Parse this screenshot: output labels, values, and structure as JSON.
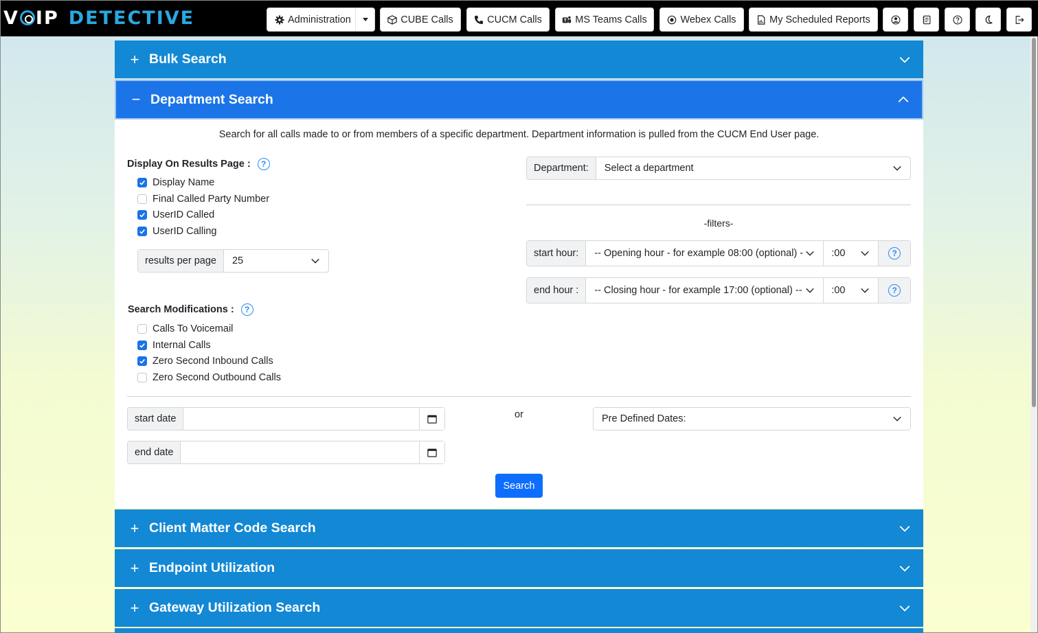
{
  "logo": {
    "part1": "V",
    "part2": "IP",
    "part3": "DETECTIVE"
  },
  "nav": {
    "administration": "Administration",
    "cube_calls": "CUBE Calls",
    "cucm_calls": "CUCM Calls",
    "ms_teams_calls": "MS Teams Calls",
    "webex_calls": "Webex Calls",
    "scheduled_reports": "My Scheduled Reports",
    "icon_buttons": [
      "user-circle-icon",
      "journal-icon",
      "question-circle-icon",
      "moon-icon",
      "logout-icon"
    ]
  },
  "accordion": {
    "bulk_search": "Bulk Search",
    "department_search": "Department Search",
    "client_matter": "Client Matter Code Search",
    "endpoint_utilization": "Endpoint Utilization",
    "gateway_utilization": "Gateway Utilization Search",
    "collapsed_sign": "+",
    "expanded_sign": "−"
  },
  "panel": {
    "intro": "Search for all calls made to or from members of a specific department. Department information is pulled from the CUCM End User page.",
    "display_title": "Display On Results Page :",
    "display_options": [
      {
        "label": "Display Name",
        "checked": true
      },
      {
        "label": "Final Called Party Number",
        "checked": false
      },
      {
        "label": "UserID Called",
        "checked": true
      },
      {
        "label": "UserID Calling",
        "checked": true
      }
    ],
    "results_per_page_label": "results per page",
    "results_per_page_value": "25",
    "mods_title": "Search Modifications :",
    "mods_options": [
      {
        "label": "Calls To Voicemail",
        "checked": false
      },
      {
        "label": "Internal Calls",
        "checked": true
      },
      {
        "label": "Zero Second Inbound Calls",
        "checked": true
      },
      {
        "label": "Zero Second Outbound Calls",
        "checked": false
      }
    ],
    "department_label": "Department:",
    "department_value": "Select a department",
    "filters_label": "-filters-",
    "start_hour_label": "start hour:",
    "start_hour_value": "-- Opening hour - for example 08:00 (optional) -",
    "start_minute_value": ":00",
    "end_hour_label": "end hour :",
    "end_hour_value": "-- Closing hour - for example 17:00 (optional) --",
    "end_minute_value": ":00",
    "start_date_label": "start date",
    "start_date_value": "",
    "end_date_label": "end date",
    "end_date_value": "",
    "or_label": "or",
    "predefined_dates": "Pre Defined Dates:",
    "search_button": "Search",
    "help_glyph": "?"
  },
  "colors": {
    "navbar": "#000000",
    "accordion": "#1388d4",
    "accordion_active": "#1c75e8",
    "primary": "#0d6efd",
    "logo_accent": "#2aa8e0"
  }
}
